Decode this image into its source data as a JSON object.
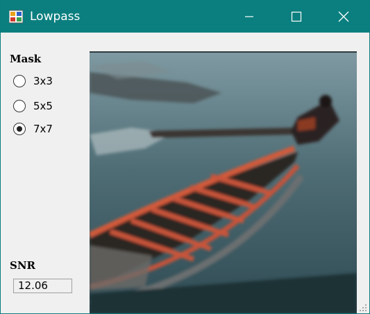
{
  "window": {
    "title": "Lowpass"
  },
  "mask": {
    "label": "Mask",
    "options": [
      "3x3",
      "5x5",
      "7x7"
    ],
    "selected": "7x7"
  },
  "snr": {
    "label": "SNR",
    "value": "12.06"
  },
  "icons": {
    "app": "app-icon",
    "minimize": "minimize-icon",
    "maximize": "maximize-icon",
    "close": "close-icon",
    "grip": "resize-grip-icon"
  },
  "colors": {
    "titlebar": "#0b7f7f",
    "window_bg": "#f0f0f0"
  }
}
